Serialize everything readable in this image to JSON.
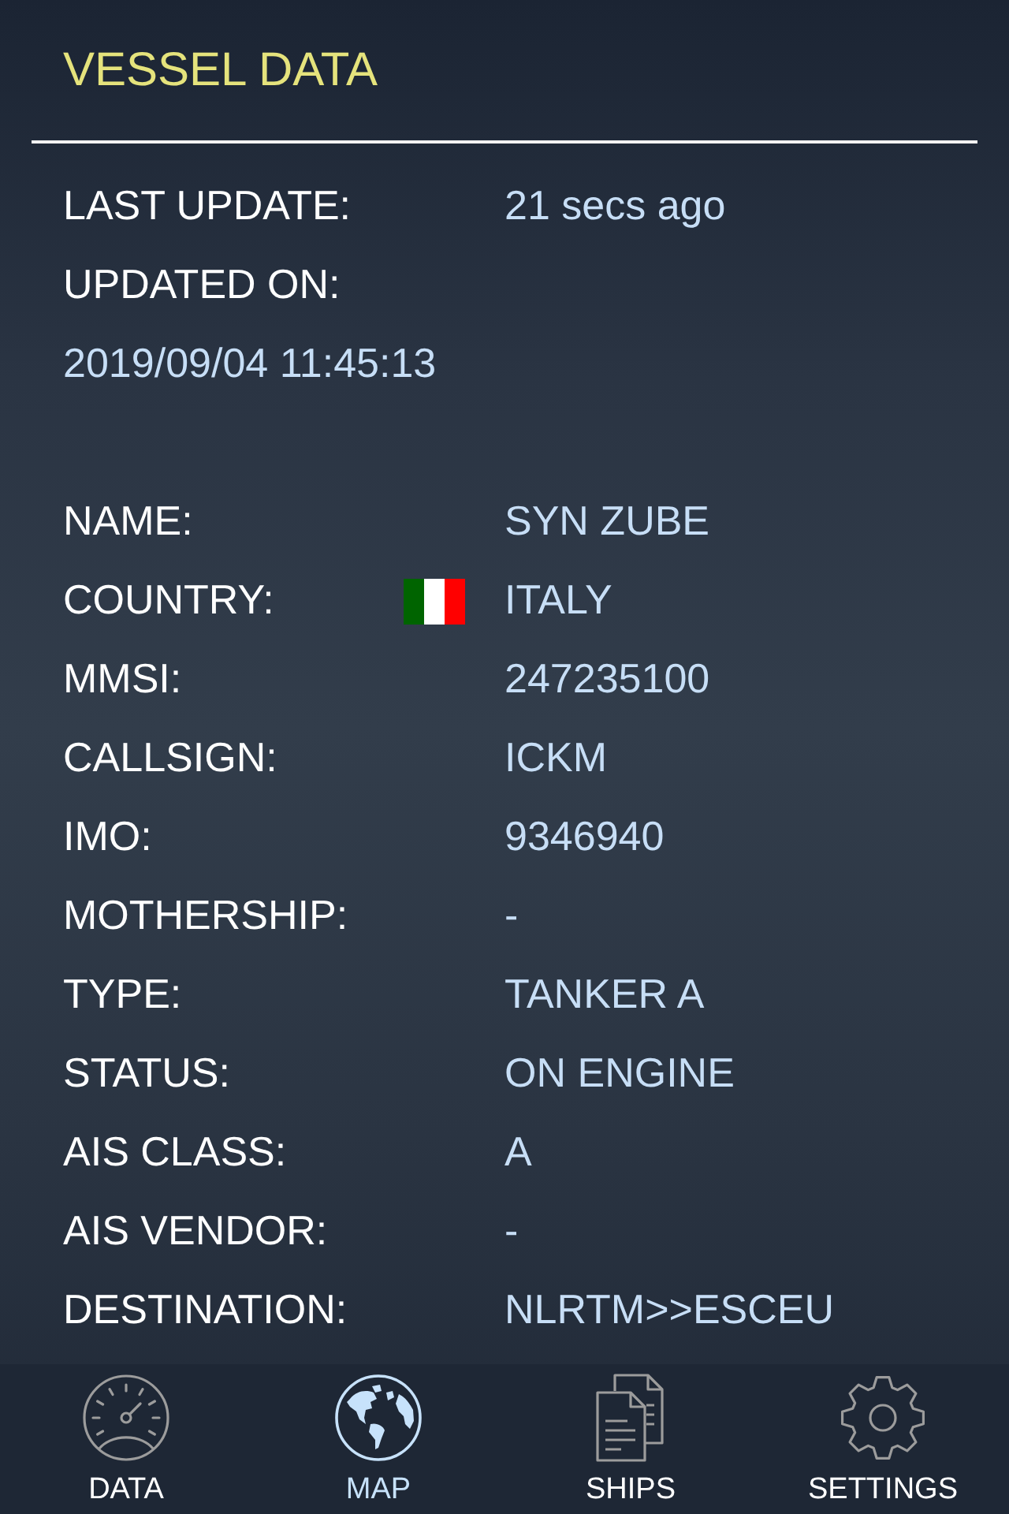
{
  "header": {
    "title": "VESSEL DATA"
  },
  "update": {
    "rows": [
      {
        "label": "LAST UPDATE:",
        "value": "21 secs ago"
      },
      {
        "label": "UPDATED ON:"
      }
    ],
    "timestamp": "2019/09/04 11:45:13"
  },
  "details": [
    {
      "kind": "text",
      "label": "NAME:",
      "value": "SYN ZUBE"
    },
    {
      "kind": "flag",
      "label": "COUNTRY:",
      "value": "ITALY"
    },
    {
      "kind": "text",
      "label": "MMSI:",
      "value": "247235100"
    },
    {
      "kind": "text",
      "label": "CALLSIGN:",
      "value": "ICKM"
    },
    {
      "kind": "text",
      "label": "IMO:",
      "value": "9346940"
    },
    {
      "kind": "text",
      "label": "MOTHERSHIP:",
      "value": "-"
    },
    {
      "kind": "text",
      "label": "TYPE:",
      "value": "TANKER A"
    },
    {
      "kind": "text",
      "label": "STATUS:",
      "value": "ON ENGINE"
    },
    {
      "kind": "text",
      "label": "AIS CLASS:",
      "value": "A"
    },
    {
      "kind": "text",
      "label": "AIS VENDOR:",
      "value": "-"
    },
    {
      "kind": "text",
      "label": "DESTINATION:",
      "value": "NLRTM>>ESCEU"
    }
  ],
  "tabs": [
    {
      "label": "DATA",
      "selected": false
    },
    {
      "label": "MAP",
      "selected": true
    },
    {
      "label": "SHIPS",
      "selected": false
    },
    {
      "label": "SETTINGS",
      "selected": false
    }
  ]
}
